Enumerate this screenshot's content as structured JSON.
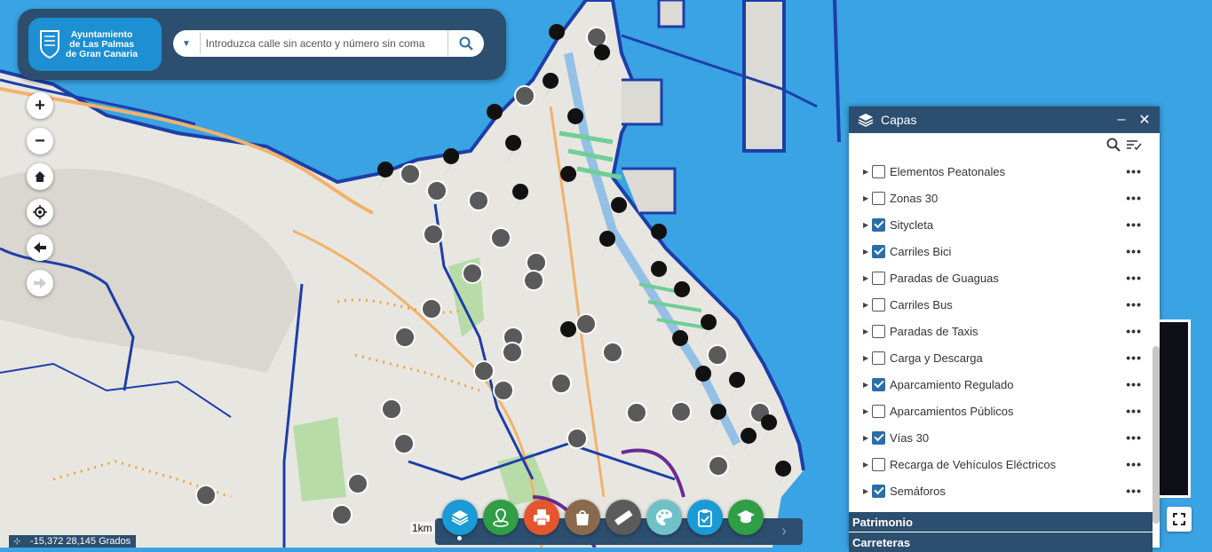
{
  "header": {
    "logo_lines": [
      "Ayuntamiento",
      "de Las Palmas",
      "de Gran Canaria"
    ],
    "search_placeholder": "Introduzca calle sin acento y número sin coma"
  },
  "map_controls": [
    {
      "name": "zoom-in-button",
      "icon": "+"
    },
    {
      "name": "zoom-out-button",
      "icon": "−"
    },
    {
      "name": "home-button",
      "icon": "home-icon"
    },
    {
      "name": "locate-button",
      "icon": "locate-icon"
    },
    {
      "name": "back-button",
      "icon": "arrow-left-icon"
    },
    {
      "name": "forward-button",
      "icon": "arrow-right-icon"
    }
  ],
  "panel": {
    "title": "Capas",
    "minimize": "–",
    "close": "✕",
    "layers": [
      {
        "label": "Elementos Peatonales",
        "checked": false
      },
      {
        "label": "Zonas 30",
        "checked": false
      },
      {
        "label": "Sitycleta",
        "checked": true
      },
      {
        "label": "Carriles Bici",
        "checked": true
      },
      {
        "label": "Paradas de Guaguas",
        "checked": false
      },
      {
        "label": "Carriles Bus",
        "checked": false
      },
      {
        "label": "Paradas de Taxis",
        "checked": false
      },
      {
        "label": "Carga y Descarga",
        "checked": false
      },
      {
        "label": "Aparcamiento Regulado",
        "checked": true
      },
      {
        "label": "Aparcamientos Públicos",
        "checked": false
      },
      {
        "label": "Vías 30",
        "checked": true
      },
      {
        "label": "Recarga de Vehículos Eléctricos",
        "checked": false
      },
      {
        "label": "Semáforos",
        "checked": true
      }
    ],
    "more_label": "•••",
    "sections": [
      "Patrimonio",
      "Carreteras"
    ]
  },
  "toolbar": {
    "buttons": [
      {
        "name": "layers-tool-button",
        "icon": "layers-icon",
        "color": "#1a9ad6"
      },
      {
        "name": "map-location-tool-button",
        "icon": "map-pin-icon",
        "color": "#2f9e44"
      },
      {
        "name": "print-tool-button",
        "icon": "printer-icon",
        "color": "#e4572e"
      },
      {
        "name": "bag-tool-button",
        "icon": "bag-icon",
        "color": "#8a6a4e"
      },
      {
        "name": "measure-tool-button",
        "icon": "ruler-icon",
        "color": "#5b5b5b"
      },
      {
        "name": "palette-tool-button",
        "icon": "palette-icon",
        "color": "#6fc1c7"
      },
      {
        "name": "clipboard-tool-button",
        "icon": "clipboard-icon",
        "color": "#1a9ad6"
      },
      {
        "name": "education-tool-button",
        "icon": "graduation-cap-icon",
        "color": "#2f9e44"
      }
    ],
    "next": "›"
  },
  "status": {
    "coordinates": "-15,372 28,145 Grados",
    "scale": "1km"
  }
}
